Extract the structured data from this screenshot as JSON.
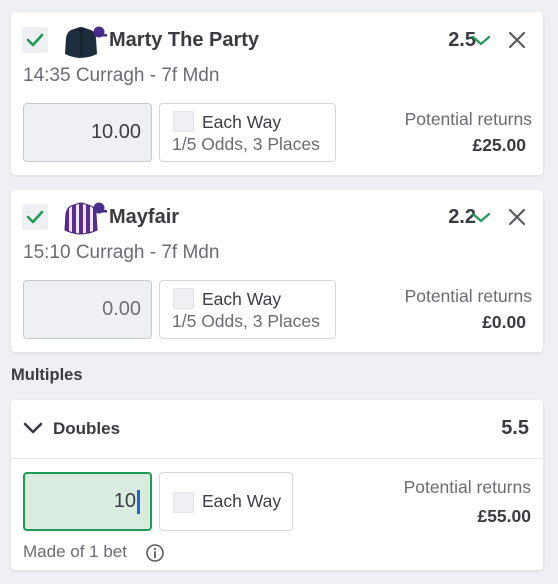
{
  "selections": [
    {
      "checked": true,
      "runner": "Marty The Party",
      "odds": "2.5",
      "race": "14:35 Curragh - 7f Mdn",
      "stake": "10.00",
      "each_way_label": "Each Way",
      "each_way_terms": "1/5 Odds, 3 Places",
      "returns_label": "Potential returns",
      "returns_value": "£25.00",
      "silk": "navy-jacket-silk-icon"
    },
    {
      "checked": true,
      "runner": "Mayfair",
      "odds": "2.2",
      "race": "15:10 Curragh - 7f Mdn",
      "stake": "0.00",
      "each_way_label": "Each Way",
      "each_way_terms": "1/5 Odds, 3 Places",
      "returns_label": "Potential returns",
      "returns_value": "£0.00",
      "silk": "purple-striped-silk-icon"
    }
  ],
  "multiples": {
    "section_title": "Multiples",
    "doubles": {
      "name": "Doubles",
      "odds": "5.5",
      "stake": "10",
      "each_way_label": "Each Way",
      "returns_label": "Potential returns",
      "returns_value": "£55.00",
      "made_of": "Made of 1 bet"
    }
  },
  "colors": {
    "accent_green": "#1e9b56",
    "caret_blue": "#1a66d8",
    "background": "#eef0f3"
  }
}
